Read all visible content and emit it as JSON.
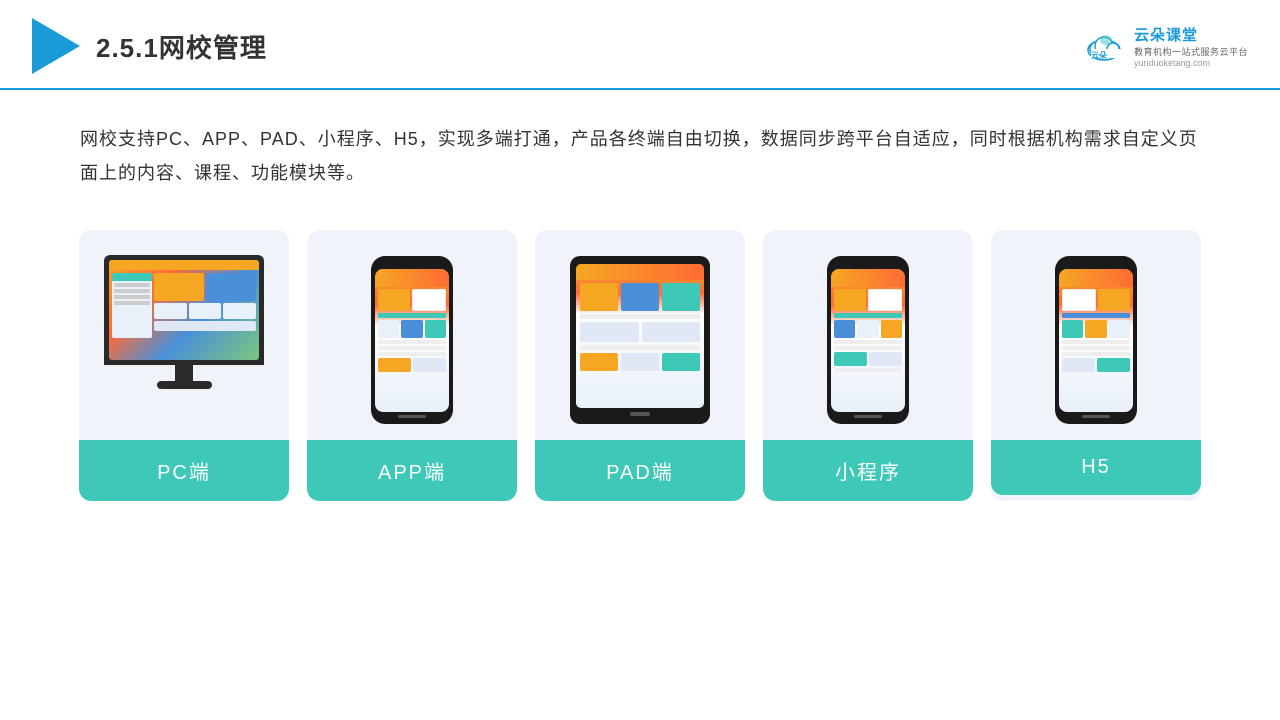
{
  "header": {
    "title": "2.5.1网校管理",
    "brand": {
      "name": "云朵课堂",
      "url": "yunduoketang.com",
      "subtitle": "教育机构一站式服务云平台"
    }
  },
  "description": "网校支持PC、APP、PAD、小程序、H5，实现多端打通，产品各终端自由切换，数据同步跨平台自适应，同时根据机构需求自定义页面上的内容、课程、功能模块等。",
  "cards": [
    {
      "id": "pc",
      "label": "PC端",
      "device": "pc"
    },
    {
      "id": "app",
      "label": "APP端",
      "device": "phone"
    },
    {
      "id": "pad",
      "label": "PAD端",
      "device": "tablet"
    },
    {
      "id": "miniprogram",
      "label": "小程序",
      "device": "phone"
    },
    {
      "id": "h5",
      "label": "H5",
      "device": "phone"
    }
  ],
  "colors": {
    "accent": "#3dc8b8",
    "header_line": "#1a9bd7",
    "text": "#333333"
  }
}
